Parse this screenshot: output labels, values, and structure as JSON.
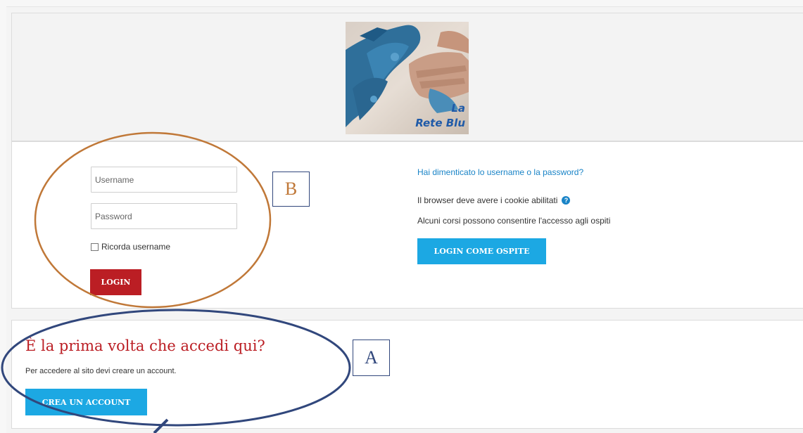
{
  "logo": {
    "text_line1": "La",
    "text_line2": "Rete Blu"
  },
  "login_form": {
    "username_placeholder": "Username",
    "password_placeholder": "Password",
    "remember_label": "Ricorda username",
    "login_button": "LOGIN"
  },
  "info": {
    "forgot_link": "Hai dimenticato lo username o la password?",
    "cookie_text": "Il browser deve avere i cookie abilitati",
    "help_icon_glyph": "?",
    "guest_text": "Alcuni corsi possono consentire l'accesso agli ospiti",
    "guest_button": "LOGIN COME OSPITE"
  },
  "signup": {
    "title": "È la prima volta che accedi qui?",
    "text": "Per accedere al sito devi creare un account.",
    "create_button": "CREA UN ACCOUNT"
  },
  "annotations": {
    "label_b": "B",
    "label_a": "A"
  },
  "colors": {
    "accent_red": "#bb1e24",
    "accent_blue": "#1ca8e3",
    "link_blue": "#1a84c7",
    "annotation_orange": "#c07838",
    "annotation_navy": "#31477c"
  }
}
